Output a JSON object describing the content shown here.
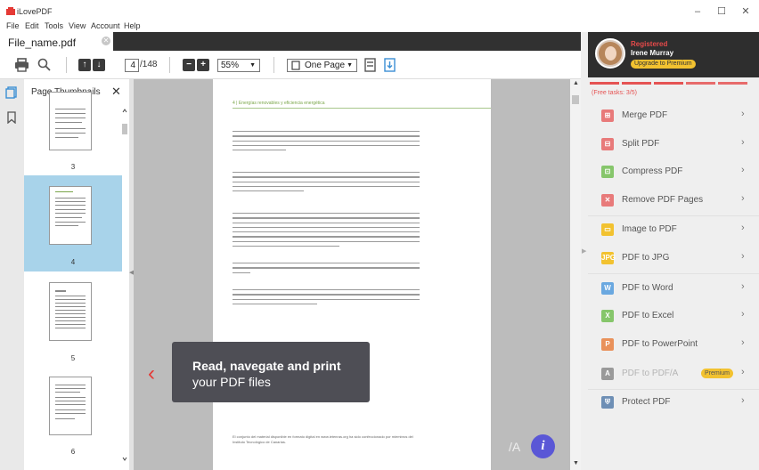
{
  "window": {
    "title": "iLovePDF",
    "controls": {
      "minimize": "–",
      "maximize": "☐",
      "close": "✕"
    }
  },
  "menu": [
    "File",
    "Edit",
    "Tools",
    "View",
    "Account",
    "Help"
  ],
  "tab": {
    "filename": "File_name.pdf",
    "close": "✕"
  },
  "toolbar": {
    "page_current": "4",
    "page_total": "/148",
    "zoom": "55%",
    "view_mode": "One Page",
    "prev_symbol": "↑",
    "next_symbol": "↓",
    "zoom_out_symbol": "−",
    "zoom_in_symbol": "+"
  },
  "thumbnails": {
    "title": "Page Thumbnails",
    "close": "✕",
    "pages": [
      "3",
      "4",
      "5",
      "6"
    ],
    "selected": "4"
  },
  "document": {
    "header": "4  |  Energías renovables y eficiencia energética",
    "footer": "El conjunto del material disponible en formato digital en www.ietenras.org ha sido confeccionado por miembros del Instituto Tecnológico de Canarias."
  },
  "overlay": {
    "line1": "Read, navegate and print",
    "line2": "your PDF files",
    "nav_prev": "‹",
    "pdfa_mark": "/A",
    "info": "i"
  },
  "profile": {
    "status": "Registered",
    "name": "Irene Murray",
    "upgrade": "Upgrade to Premium"
  },
  "tasks": {
    "free_label": "(Free tasks: 3/5)",
    "progress_used_fraction": 0.6
  },
  "tools": [
    {
      "label": "Merge PDF",
      "icon": "merge-icon",
      "color": "#e87a7a",
      "glyph": "⊞",
      "enabled": true
    },
    {
      "label": "Split PDF",
      "icon": "split-icon",
      "color": "#e87a7a",
      "glyph": "⊟",
      "enabled": true
    },
    {
      "label": "Compress PDF",
      "icon": "compress-icon",
      "color": "#86c66b",
      "glyph": "⊡",
      "enabled": true
    },
    {
      "label": "Remove PDF Pages",
      "icon": "remove-pages-icon",
      "color": "#e87a7a",
      "glyph": "✕",
      "enabled": true
    },
    {
      "label": "Image to PDF",
      "icon": "image-to-pdf-icon",
      "color": "#f2c230",
      "glyph": "▭",
      "enabled": true
    },
    {
      "label": "PDF to JPG",
      "icon": "pdf-to-jpg-icon",
      "color": "#f2c230",
      "glyph": "JPG",
      "enabled": true
    },
    {
      "label": "PDF to Word",
      "icon": "pdf-to-word-icon",
      "color": "#6aa8e0",
      "glyph": "W",
      "enabled": true
    },
    {
      "label": "PDF to Excel",
      "icon": "pdf-to-excel-icon",
      "color": "#86c66b",
      "glyph": "X",
      "enabled": true
    },
    {
      "label": "PDF to PowerPoint",
      "icon": "pdf-to-powerpoint-icon",
      "color": "#e9915a",
      "glyph": "P",
      "enabled": true
    },
    {
      "label": "PDF to PDF/A",
      "icon": "pdf-to-pdfa-icon",
      "color": "#9a9a9a",
      "glyph": "A",
      "enabled": false,
      "badge": "Premium"
    },
    {
      "label": "Protect PDF",
      "icon": "protect-pdf-icon",
      "color": "#6e8fb5",
      "glyph": "⛨",
      "enabled": true
    }
  ],
  "chevron": "›"
}
